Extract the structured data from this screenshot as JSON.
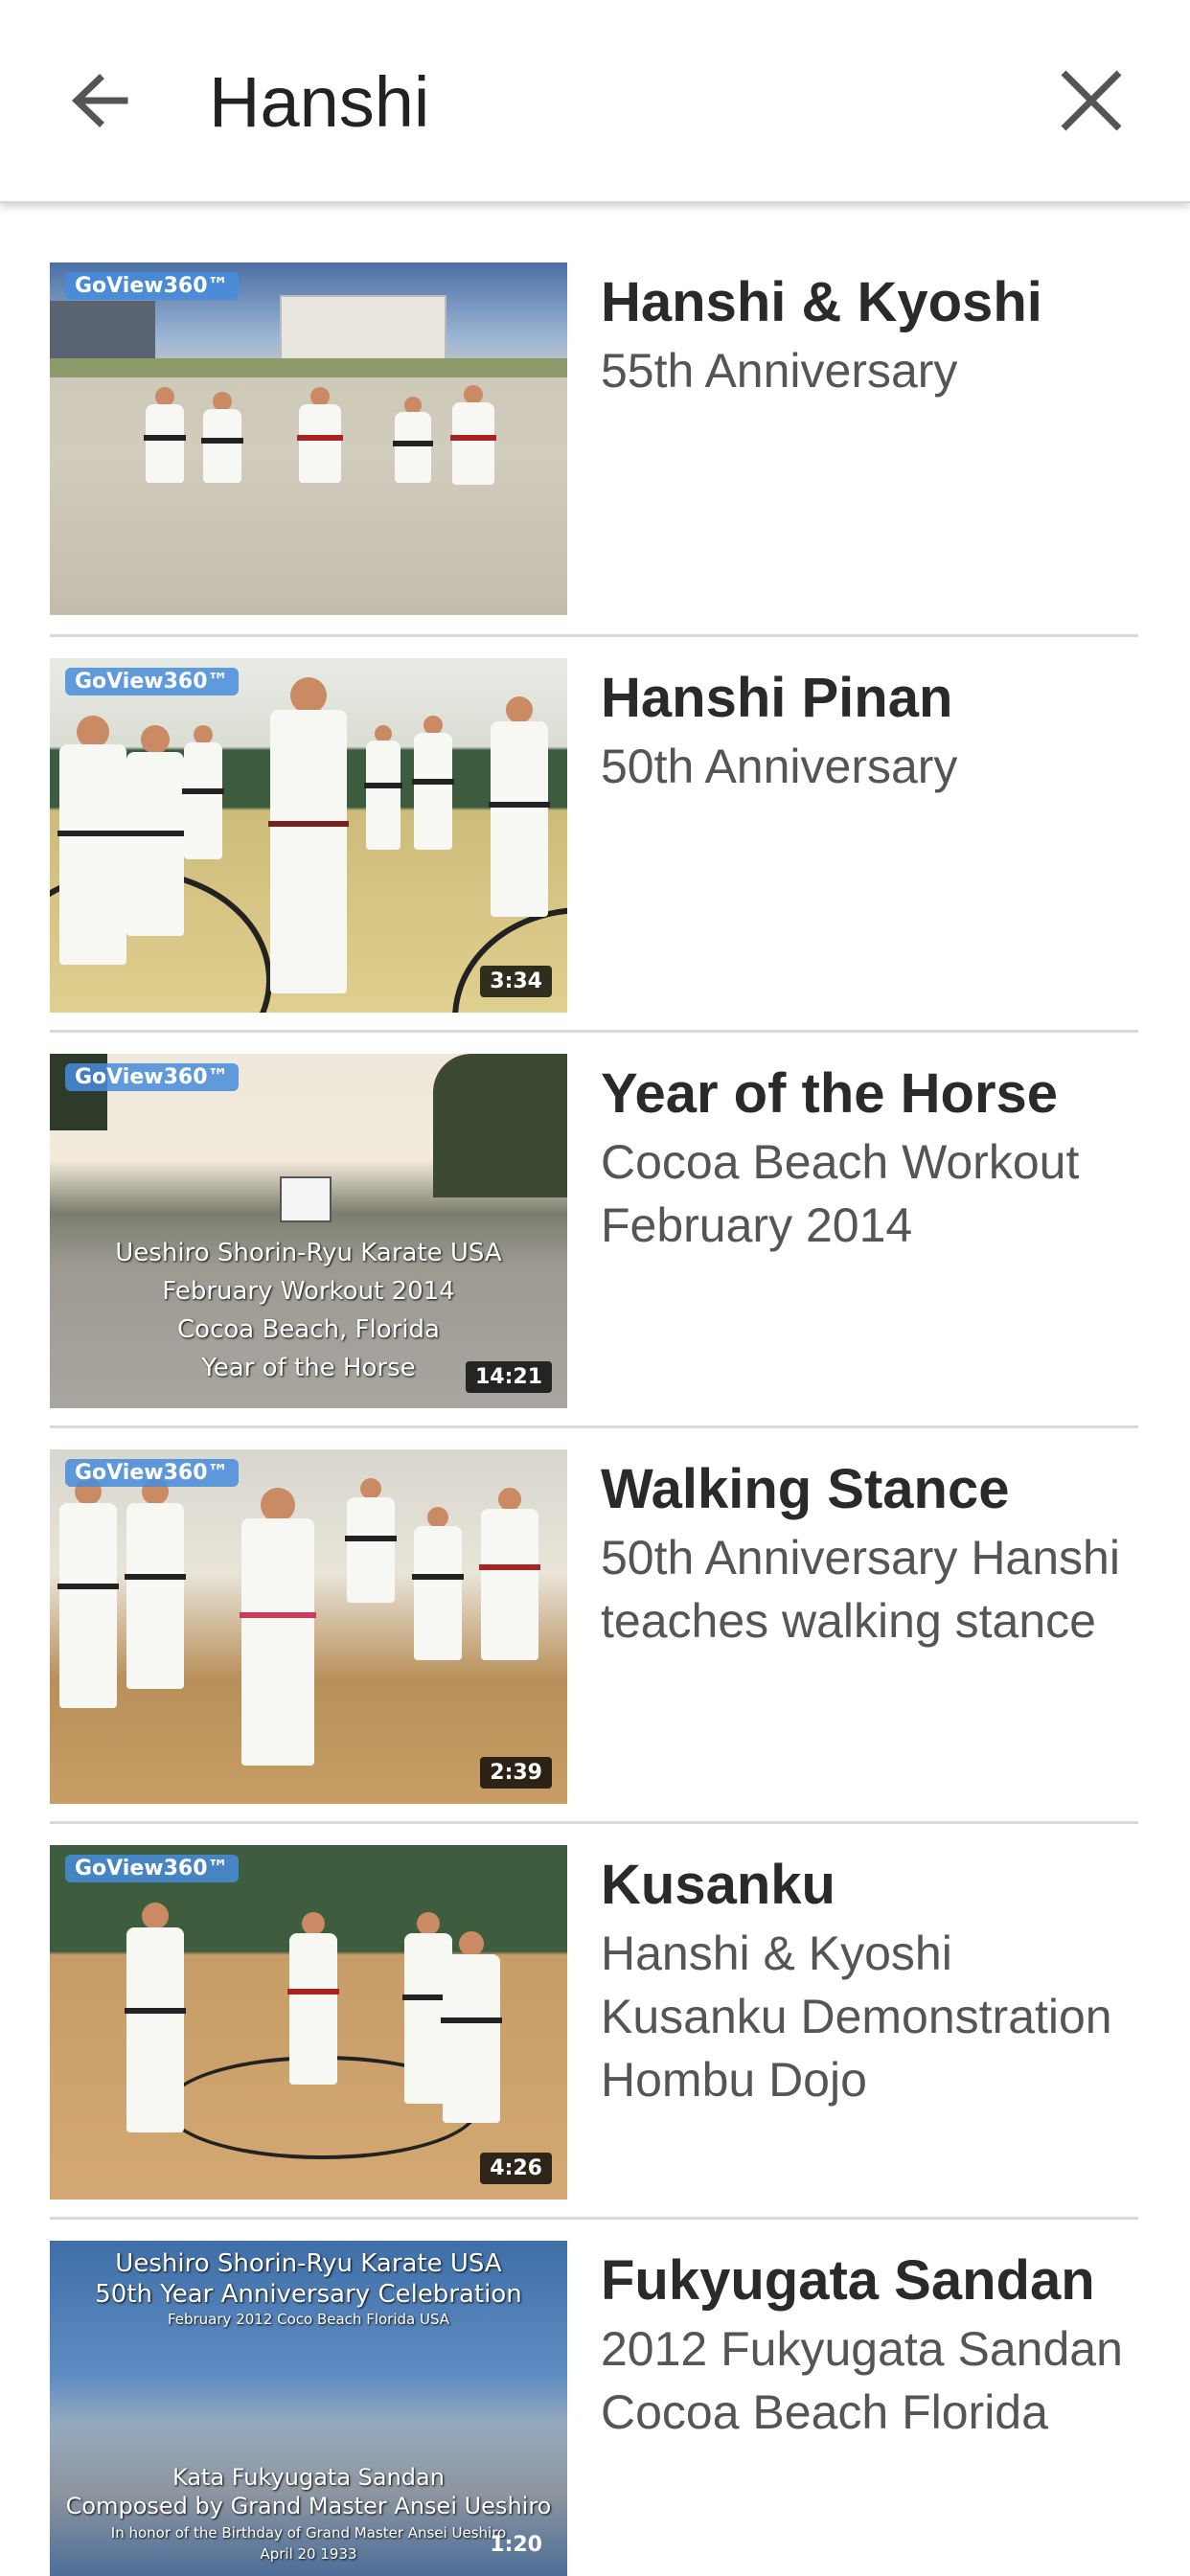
{
  "search": {
    "query": "Hanshi"
  },
  "icons": {
    "back": "arrow-left-icon",
    "clear": "close-icon"
  },
  "results": [
    {
      "title": "Hanshi & Kyoshi",
      "description": "55th Anniversary",
      "brand": "GoView360™",
      "duration": ""
    },
    {
      "title": "Hanshi Pinan",
      "description": "50th Anniversary",
      "brand": "GoView360™",
      "duration": "3:34"
    },
    {
      "title": "Year of the Horse",
      "description": "Cocoa Beach Workout February 2014",
      "brand": "GoView360™",
      "duration": "14:21",
      "thumb_caption": [
        "Ueshiro Shorin-Ryu Karate USA",
        "February Workout 2014",
        "Cocoa Beach, Florida",
        "Year of the Horse"
      ]
    },
    {
      "title": "Walking Stance",
      "description": "50th Anniversary Hanshi teaches walking stance",
      "brand": "GoView360™",
      "duration": "2:39"
    },
    {
      "title": "Kusanku",
      "description": "Hanshi & Kyoshi Kusanku Demonstration Hombu Dojo",
      "brand": "GoView360™",
      "duration": "4:26"
    },
    {
      "title": "Fukyugata Sandan",
      "description": "2012 Fukyugata Sandan Cocoa Beach Florida",
      "brand": "",
      "duration": "1:20",
      "thumb_caption_top": [
        "Ueshiro Shorin-Ryu Karate USA",
        "50th Year Anniversary Celebration",
        "February 2012 Coco Beach Florida USA"
      ],
      "thumb_caption_bottom": [
        "Kata Fukyugata Sandan",
        "Composed by Grand Master Ansei Ueshiro",
        "In honor of the Birthday of Grand Master Ansei Ueshiro",
        "April 20 1933"
      ]
    }
  ],
  "colors": {
    "title_text": "#2a2a2a",
    "desc_text": "#555555",
    "divider": "#d9d9d9",
    "brand_badge": "#468cdc"
  }
}
